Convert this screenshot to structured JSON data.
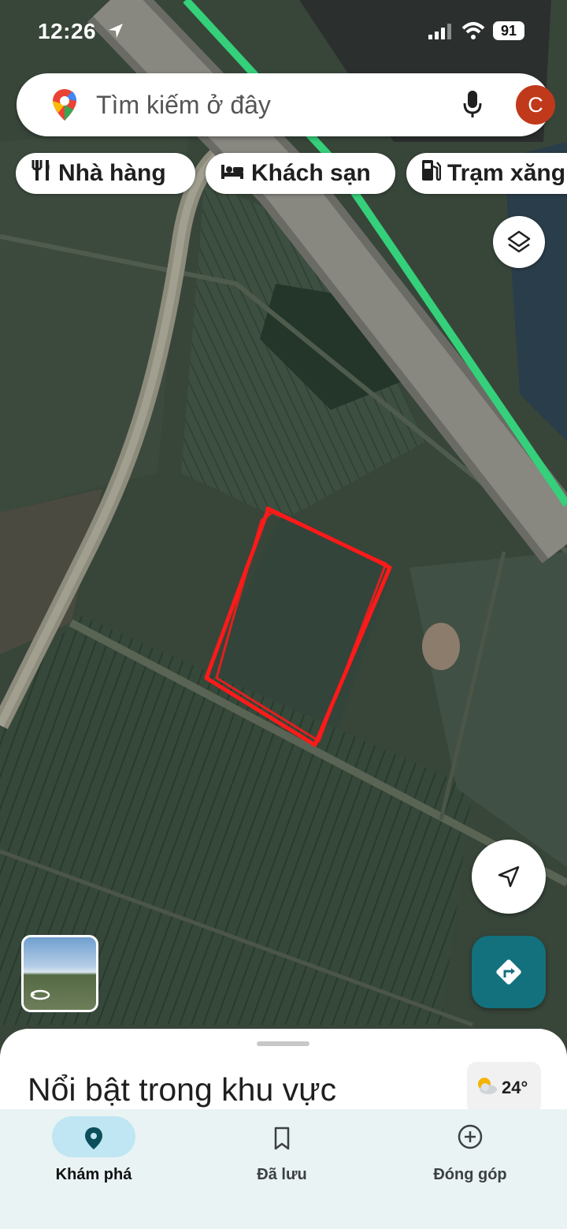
{
  "status_bar": {
    "time": "12:26",
    "battery": "91",
    "icons": [
      "location-arrow-icon",
      "signal-icon",
      "wifi-icon",
      "battery-icon"
    ]
  },
  "search": {
    "placeholder": "Tìm kiếm ở đây",
    "avatar_initial": "C",
    "avatar_color": "#c0391b",
    "icons": [
      "maps-pin-icon",
      "microphone-icon"
    ]
  },
  "chips": [
    {
      "label": "Nhà hàng",
      "icon": "restaurant-icon"
    },
    {
      "label": "Khách sạn",
      "icon": "hotel-icon"
    },
    {
      "label": "Trạm xăng",
      "icon": "gas-station-icon"
    }
  ],
  "map": {
    "view": "satellite",
    "road_highlight_color": "#35d07a",
    "drawn_outline_color": "#ff1a1a"
  },
  "bottom_sheet": {
    "title": "Nổi bật trong khu vực",
    "weather": {
      "temp": "24°",
      "icon": "partly-cloudy-icon"
    }
  },
  "bottom_nav": {
    "items": [
      {
        "label": "Khám phá",
        "icon": "explore-pin-icon",
        "active": true
      },
      {
        "label": "Đã lưu",
        "icon": "bookmark-icon",
        "active": false
      },
      {
        "label": "Đóng góp",
        "icon": "add-circle-icon",
        "active": false
      }
    ],
    "active_color": "#bfe6f2"
  },
  "accent": {
    "directions_button": "#13717e"
  }
}
